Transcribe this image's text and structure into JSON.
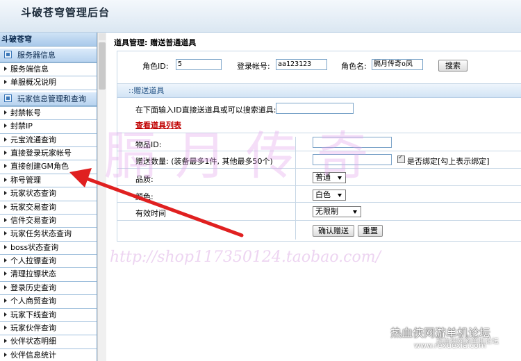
{
  "header": {
    "title": "斗破苍穹管理后台"
  },
  "sidebar": {
    "root": "斗破苍穹",
    "group1": {
      "label": "服务器信息",
      "items": [
        "服务端信息",
        "单服概况说明"
      ]
    },
    "group2": {
      "label": "玩家信息管理和查询",
      "items": [
        "封禁帐号",
        "封禁IP",
        "元宝流通查询",
        "直接登录玩家帐号",
        "直接创建GM角色",
        "称号管理",
        "玩家状态查询",
        "玩家交易查询",
        "信件交易查询",
        "玩家任务状态查询",
        "boss状态查询",
        "个人拉镖查询",
        "清理拉镖状态",
        "登录历史查询",
        "个人商贸查询",
        "玩家下线查询",
        "玩家伙伴查询",
        "伙伴状态明细",
        "伙伴信息统计"
      ]
    }
  },
  "main": {
    "breadcrumb": "道具管理: 赠送普通道具",
    "search": {
      "role_id_label": "角色ID:",
      "role_id_value": "5",
      "account_label": "登录帐号:",
      "account_value": "aa123123",
      "role_name_label": "角色名:",
      "role_name_value": "膈月传奇o凤",
      "search_button": "搜索"
    },
    "form": {
      "section_title": "::赠送道具",
      "hint_label": "在下面输入ID直接送道具或可以搜索道具:",
      "hint_value": "",
      "item_list_link": "查看道具列表",
      "item_id_label": "物品ID:",
      "item_id_value": "",
      "quantity_label": "赠送数量: (装备最多1件, 其他最多50个)",
      "quantity_value": "",
      "bind_label": "是否绑定[勾上表示绑定]",
      "quality_label": "品质:",
      "quality_value": "普通",
      "color_label": "颜色:",
      "color_value": "白色",
      "expire_label": "有效时间",
      "expire_value": "无限制",
      "confirm_button": "确认赠送",
      "reset_button": "重置"
    }
  },
  "watermark": {
    "text": "膈月传奇",
    "url": "http://shop117350124.taobao.com/"
  },
  "forum": {
    "tag": "热血侠网游单机论坛",
    "sub": "热血侠网游单机论坛",
    "url": "www.rexuexia.com"
  },
  "colors": {
    "accent": "#3b77b8",
    "link": "#c00000",
    "arrow": "#e02020"
  }
}
